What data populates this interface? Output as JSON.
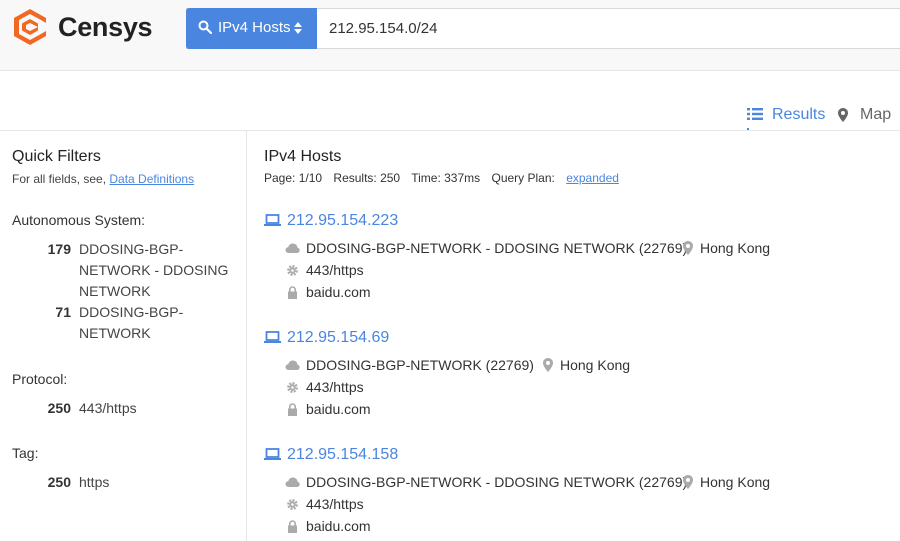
{
  "brand": {
    "name": "Censys",
    "color": "#f26722"
  },
  "search": {
    "type_label": "IPv4 Hosts",
    "query": "212.95.154.0/24",
    "search_icon": "search-icon",
    "caret_icon": "sort-caret-icon"
  },
  "tabs": {
    "results_label": "Results",
    "map_label": "Map"
  },
  "sidebar": {
    "title": "Quick Filters",
    "subtitle_prefix": "For all fields, see",
    "subtitle_link": "Data Definitions",
    "facets": [
      {
        "title": "Autonomous System:",
        "items": [
          {
            "count": "179",
            "name": "DDOSING-BGP-NETWORK - DDOSING NETWORK"
          },
          {
            "count": "71",
            "name": "DDOSING-BGP-NETWORK"
          }
        ]
      },
      {
        "title": "Protocol:",
        "items": [
          {
            "count": "250",
            "name": "443/https"
          }
        ]
      },
      {
        "title": "Tag:",
        "items": [
          {
            "count": "250",
            "name": "https"
          }
        ]
      }
    ]
  },
  "results": {
    "title": "IPv4 Hosts",
    "page": "Page: 1/10",
    "count": "Results: 250",
    "time": "Time: 337ms",
    "query_plan_label": "Query Plan:",
    "query_plan_link": "expanded",
    "accent": "#4a86e0",
    "items": [
      {
        "ip": "212.95.154.223",
        "asn": "DDOSING-BGP-NETWORK - DDOSING NETWORK (22769)",
        "location": "Hong Kong",
        "protocol": "443/https",
        "domain": "baidu.com"
      },
      {
        "ip": "212.95.154.69",
        "asn": "DDOSING-BGP-NETWORK (22769)",
        "location": "Hong Kong",
        "protocol": "443/https",
        "domain": "baidu.com"
      },
      {
        "ip": "212.95.154.158",
        "asn": "DDOSING-BGP-NETWORK - DDOSING NETWORK (22769)",
        "location": "Hong Kong",
        "protocol": "443/https",
        "domain": "baidu.com"
      }
    ]
  }
}
